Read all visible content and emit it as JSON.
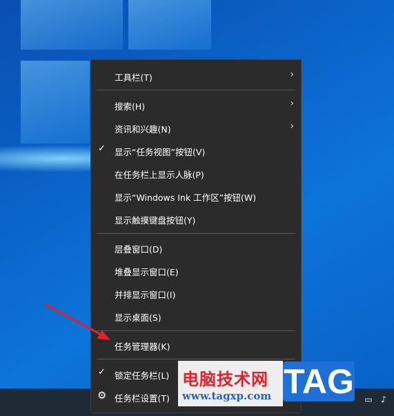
{
  "menu": {
    "items": [
      {
        "label": "工具栏(T)",
        "has_submenu": true
      },
      {
        "label": "搜索(H)",
        "has_submenu": true
      },
      {
        "label": "资讯和兴趣(N)",
        "has_submenu": true
      },
      {
        "label": "显示“任务视图”按钮(V)",
        "checked": true
      },
      {
        "label": "在任务栏上显示人脉(P)"
      },
      {
        "label": "显示“Windows Ink 工作区”按钮(W)"
      },
      {
        "label": "显示触摸键盘按钮(Y)"
      },
      {
        "label": "层叠窗口(D)"
      },
      {
        "label": "堆叠显示窗口(E)"
      },
      {
        "label": "并排显示窗口(I)"
      },
      {
        "label": "显示桌面(S)"
      },
      {
        "label": "任务管理器(K)"
      },
      {
        "label": "锁定任务栏(L)",
        "checked": true
      },
      {
        "label": "任务栏设置(T)",
        "icon": "gear-icon"
      }
    ]
  },
  "watermark": {
    "title": "电脑技术网",
    "url": "www.tagxp.com",
    "badge": "TAG"
  },
  "colors": {
    "menu_bg": "#2b2b2b",
    "arrow": "#e3212a",
    "desktop": "#0b63c9"
  }
}
